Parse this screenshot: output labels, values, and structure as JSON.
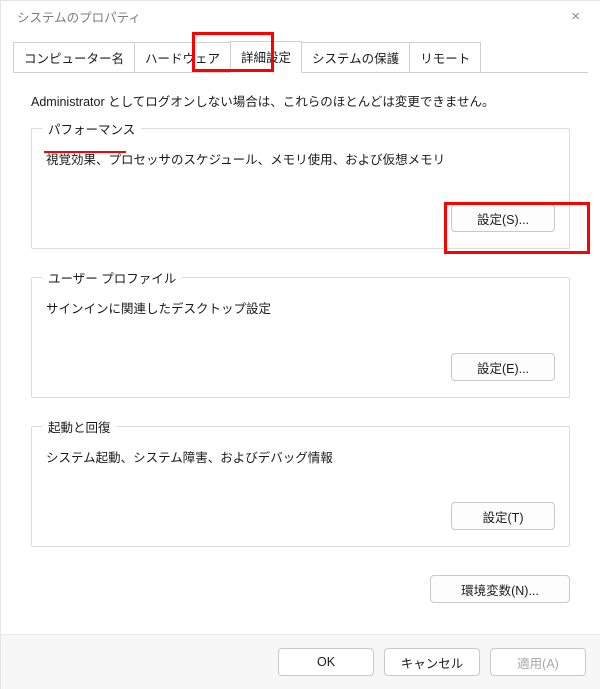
{
  "window": {
    "title": "システムのプロパティ",
    "close_glyph": "×"
  },
  "tabs": [
    {
      "label": "コンピューター名"
    },
    {
      "label": "ハードウェア"
    },
    {
      "label": "詳細設定",
      "active": true
    },
    {
      "label": "システムの保護"
    },
    {
      "label": "リモート"
    }
  ],
  "panel": {
    "admin_note": "Administrator としてログオンしない場合は、これらのほとんどは変更できません。",
    "groups": {
      "performance": {
        "legend": "パフォーマンス",
        "desc": "視覚効果、プロセッサのスケジュール、メモリ使用、および仮想メモリ",
        "button": "設定(S)..."
      },
      "user_profiles": {
        "legend": "ユーザー プロファイル",
        "desc": "サインインに関連したデスクトップ設定",
        "button": "設定(E)..."
      },
      "startup_recovery": {
        "legend": "起動と回復",
        "desc": "システム起動、システム障害、およびデバッグ情報",
        "button": "設定(T)"
      }
    },
    "env_button": "環境変数(N)..."
  },
  "dialog_buttons": {
    "ok": "OK",
    "cancel": "キャンセル",
    "apply": "適用(A)"
  },
  "colors": {
    "highlight": "#ff0000",
    "border": "#cfcfcf",
    "text": "#1a1a1a",
    "muted": "#7d7d7d",
    "footer_bg": "#f7f7f7"
  }
}
